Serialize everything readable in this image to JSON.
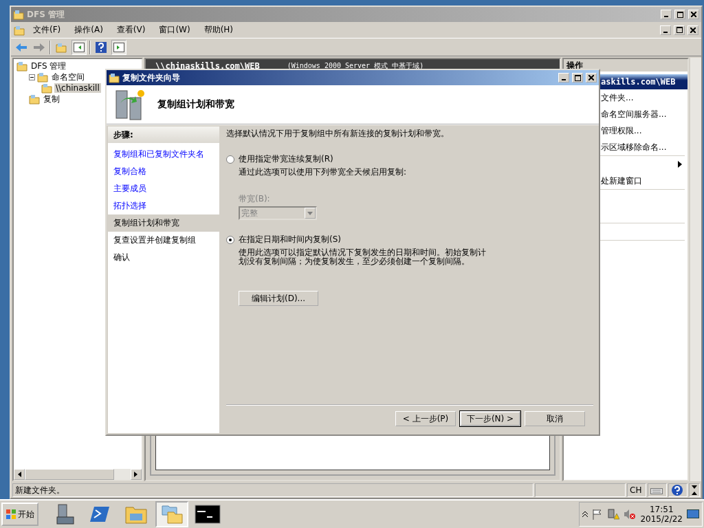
{
  "window": {
    "title": "DFS 管理"
  },
  "menu": [
    {
      "label": "文件(F)"
    },
    {
      "label": "操作(A)"
    },
    {
      "label": "查看(V)"
    },
    {
      "label": "窗口(W)"
    },
    {
      "label": "帮助(H)"
    }
  ],
  "tree": [
    {
      "label": "DFS 管理",
      "selected": false,
      "children": [
        {
          "label": "命名空间",
          "expanded": true,
          "selected": false,
          "children": [
            {
              "label": "\\\\chinaskill",
              "selected": true
            }
          ]
        },
        {
          "label": "复制",
          "selected": false
        }
      ]
    }
  ],
  "center": {
    "header": "\\\\chinaskills.com\\WEB",
    "mode": "(Windows 2000 Server 模式 中基于域)"
  },
  "actions": {
    "title": "操作",
    "section": "askills.com\\WEB",
    "items": [
      {
        "kind": "item",
        "label": "文件夹..."
      },
      {
        "kind": "item",
        "label": "命名空间服务器..."
      },
      {
        "kind": "item",
        "label": "管理权限..."
      },
      {
        "kind": "item",
        "label": "示区域移除命名..."
      },
      {
        "kind": "separator"
      },
      {
        "kind": "submenu"
      },
      {
        "kind": "item",
        "label": "处新建窗口"
      },
      {
        "kind": "separator"
      },
      {
        "kind": "blank"
      },
      {
        "kind": "blank"
      },
      {
        "kind": "separator"
      },
      {
        "kind": "blank"
      },
      {
        "kind": "separator"
      },
      {
        "kind": "blank"
      }
    ]
  },
  "status_bar": {
    "text": "新建文件夹。",
    "language": "CH"
  },
  "wizard": {
    "title": "复制文件夹向导",
    "heading": "复制组计划和带宽",
    "steps_title": "步骤:",
    "steps": [
      {
        "label": "复制组和已复制文件夹名",
        "visited": true,
        "selected": false
      },
      {
        "label": "复制合格",
        "visited": true,
        "selected": false
      },
      {
        "label": "主要成员",
        "visited": true,
        "selected": false
      },
      {
        "label": "拓扑选择",
        "visited": true,
        "selected": false
      },
      {
        "label": "复制组计划和带宽",
        "visited": false,
        "selected": true
      },
      {
        "label": "复查设置并创建复制组",
        "visited": false,
        "selected": false
      },
      {
        "label": "确认",
        "visited": false,
        "selected": false
      }
    ],
    "intro": "选择默认情况下用于复制组中所有新连接的复制计划和带宽。",
    "options": [
      {
        "label": "使用指定带宽连续复制(R)",
        "selected": false,
        "description": "通过此选项可以使用下列带宽全天候启用复制:",
        "bandwidth": {
          "label": "带宽(B):",
          "value": "完整",
          "disabled": true
        }
      },
      {
        "label": "在指定日期和时间内复制(S)",
        "selected": true,
        "description": "使用此选项可以指定默认情况下复制发生的日期和时间。初始复制计划没有复制间隔；为使复制发生，至少必须创建一个复制间隔。",
        "button": "编辑计划(D)..."
      }
    ],
    "buttons": [
      {
        "label": "< 上一步(P)",
        "default": false
      },
      {
        "label": "下一步(N) >",
        "default": true
      },
      {
        "label": "取消",
        "default": false
      }
    ]
  },
  "taskbar": {
    "start": "开始",
    "apps": [
      {
        "kind": "server",
        "active": false
      },
      {
        "kind": "powershell",
        "active": false
      },
      {
        "kind": "explorer",
        "active": false
      },
      {
        "kind": "dfs",
        "active": true
      },
      {
        "kind": "cmd",
        "active": false
      }
    ],
    "time": "17:51",
    "date": "2015/2/22"
  }
}
